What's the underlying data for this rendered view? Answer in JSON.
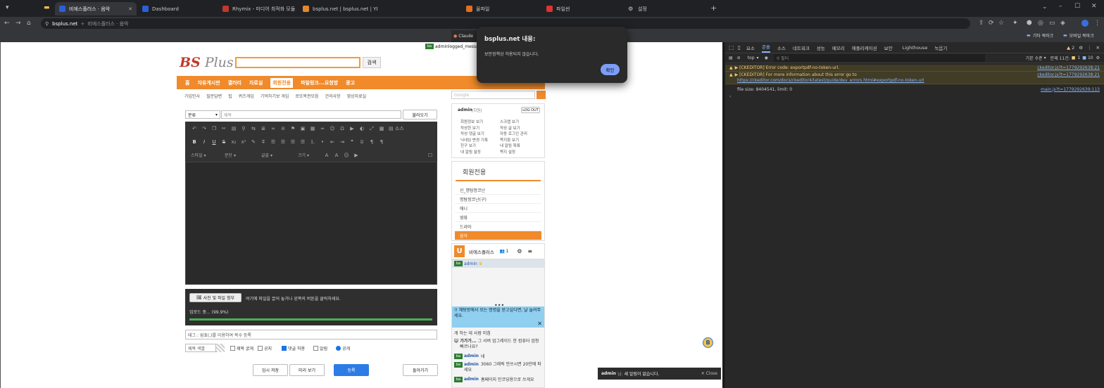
{
  "tabs": [
    {
      "label": "비에스플러스 · 음악",
      "color": "#2b5fd9",
      "active": true
    },
    {
      "label": "Dashboard",
      "color": "#2b5fd9",
      "active": false
    },
    {
      "label": "Rhymix - 미디어 최적화 모듈 개발",
      "color": "#c0392b",
      "active": false
    },
    {
      "label": "bsplus.net | bsplus.net | Ybs7415",
      "color": "#e08a2b",
      "active": false
    },
    {
      "label": "올파일",
      "color": "#e07020",
      "active": false
    },
    {
      "label": "파일썬",
      "color": "#d33",
      "active": false
    },
    {
      "label": "설정",
      "color": "#888",
      "active": false
    }
  ],
  "address": {
    "domain": "bsplus.net",
    "rest": "비에스플러스 · 음악"
  },
  "bookmarks": {
    "other": "기타 북마크",
    "mobile": "모바일 북마크"
  },
  "claude_label": "Claude",
  "site": {
    "logo_bs": "BS",
    "logo_plus": " Plus",
    "search_btn": "검색",
    "login_msg": "adminlogged_message",
    "nav": [
      "홈",
      "자유게시판",
      "갤러리",
      "자료실",
      "회원전용",
      "파일링크...요청방",
      "광고"
    ],
    "nav_active": 4,
    "subnav": [
      "가입인사",
      "질문답변",
      "팁",
      "퀴즈게임",
      "기억하기보 게임",
      "로또복권모음",
      "건의사항",
      "영상자료실"
    ],
    "google_placeholder": "Google"
  },
  "editor": {
    "category": "분류",
    "title_placeholder": "제목",
    "load_btn": "불러오기",
    "source_btn": "소스",
    "style_sel": "스타일",
    "para_sel": "문단",
    "font_sel": "글꼴",
    "size_sel": "크기",
    "attach_btn": "사진 및 파일 첨부",
    "attach_hint": "여기에 파일을 끌어 놓거나 왼쪽의 버튼을 클릭하세요.",
    "upload_status": "업로드 중... (99.9%)",
    "upload_progress": 0.999,
    "tag_hint": "태그 : 쉼표(,)를 이용하여 복수 등록",
    "title_color": "제목 색깔",
    "options": [
      {
        "label": "제목 굵게",
        "checked": false
      },
      {
        "label": "공지",
        "checked": false
      },
      {
        "label": "댓글 허용",
        "checked": true
      },
      {
        "label": "알림",
        "checked": false
      }
    ],
    "public_label": "공개",
    "buttons": {
      "temp": "임시 저장",
      "preview": "미리 보기",
      "submit": "등록",
      "back": "돌아가기"
    }
  },
  "sidebar": {
    "user": "admin",
    "user_tag": "[회원]",
    "logout": "LOG OUT",
    "links_left": [
      "회원정보 보기",
      "작성한 보기",
      "작성 댓글 보기",
      "닉네임 변경 기록",
      "친구 보기",
      "내 알림 설정"
    ],
    "links_right": [
      "스크랩 보기",
      "작성 글 보기",
      "자동 로그인 관리",
      "쪽지함 보기",
      "내 알림 목록",
      "쪽지 설정"
    ],
    "section_title": "회원전용",
    "categories": [
      "신_명탐정코난",
      "명탐정코난(구)",
      "애니",
      "영화",
      "드라마",
      "음악"
    ],
    "active_category": 5
  },
  "chat": {
    "room": "비에스플러스",
    "count": "1",
    "admin_name": "admin",
    "notice": "!! 채팅방에서 모는 명령을 받고싶다면, 날 놀려주세요.",
    "lines": [
      {
        "name": "",
        "text": "게 하는 데 사람 미침"
      },
      {
        "name": "가가가...",
        "text": "그 서버 업그레이드 한 컴퓨터 엄청 빠르나요?"
      },
      {
        "name": "admin",
        "text": "네"
      },
      {
        "name": "admin",
        "text": "3060 그래픽 안쓰시면 20만에 파세요"
      },
      {
        "name": "admin",
        "text": "홈페이지 인코딩용으로 쓰게요"
      }
    ]
  },
  "toast": {
    "user": "admin",
    "msg": "새 알림이 없습니다.",
    "close": "Close"
  },
  "dialog": {
    "title": "bsplus.net 내용:",
    "msg": "보안정책상 허용되지 않습니다.",
    "ok": "확인"
  },
  "devtools": {
    "tabs": [
      "요소",
      "콘솔",
      "소스",
      "네트워크",
      "성능",
      "메모리",
      "애플리케이션",
      "보안",
      "Lighthouse",
      "녹음기"
    ],
    "active_tab": 1,
    "context": "top",
    "filter": "필터",
    "level": "기본 수준",
    "issues": "문제 11건:",
    "warn_count": "2",
    "issue_a": "1",
    "issue_b": "10",
    "lines": [
      {
        "type": "warn",
        "text": "▶ [CKEDITOR] Error code: exportpdf-no-token-url.",
        "src": "ckeditor.js?t=1779292638:21"
      },
      {
        "type": "warn",
        "text": "▶ [CKEDITOR] For more information about this error go to",
        "link": "https://ckeditor.com/docs/ckeditor4/latest/guide/dev_errors.html#exportpdf-no-token-url",
        "src": "ckeditor.js?t=1779292638:21"
      },
      {
        "type": "log",
        "text": "file size: 8404541, limit: 0",
        "src": "main.js?t=1779292639:113"
      }
    ]
  }
}
